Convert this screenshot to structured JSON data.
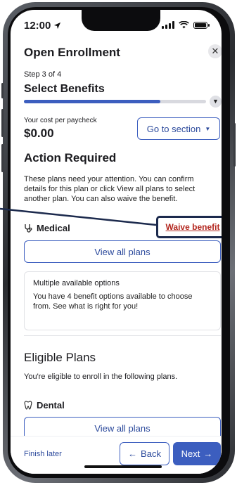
{
  "status_bar": {
    "time": "12:00"
  },
  "header": {
    "title": "Open Enrollment",
    "close_icon": "close-icon"
  },
  "progress": {
    "step_label": "Step 3 of 4",
    "step_title": "Select Benefits",
    "fraction": 0.75
  },
  "cost": {
    "label": "Your cost per paycheck",
    "value": "$0.00"
  },
  "go_to_section": {
    "label": "Go to section"
  },
  "action_required": {
    "title": "Action Required",
    "description": "These plans need your attention. You can confirm details for this plan or click View all plans to select another plan. You can also waive the benefit."
  },
  "medical": {
    "label": "Medical",
    "icon": "stethoscope-icon",
    "waive_label": "Waive benefit",
    "view_all_label": "View all plans",
    "info_title": "Multiple available options",
    "info_text": "You have 4 benefit options available to choose from. See what is right for you!"
  },
  "eligible_plans": {
    "title": "Eligible Plans",
    "description": "You're eligible to enroll in the following plans."
  },
  "dental": {
    "label": "Dental",
    "icon": "tooth-icon",
    "view_all_label": "View all plans"
  },
  "footer": {
    "finish_later": "Finish later",
    "back_label": "Back",
    "next_label": "Next"
  },
  "colors": {
    "primary": "#3c5ebf",
    "danger": "#b3261e",
    "highlight_border": "#1c2a4d"
  }
}
